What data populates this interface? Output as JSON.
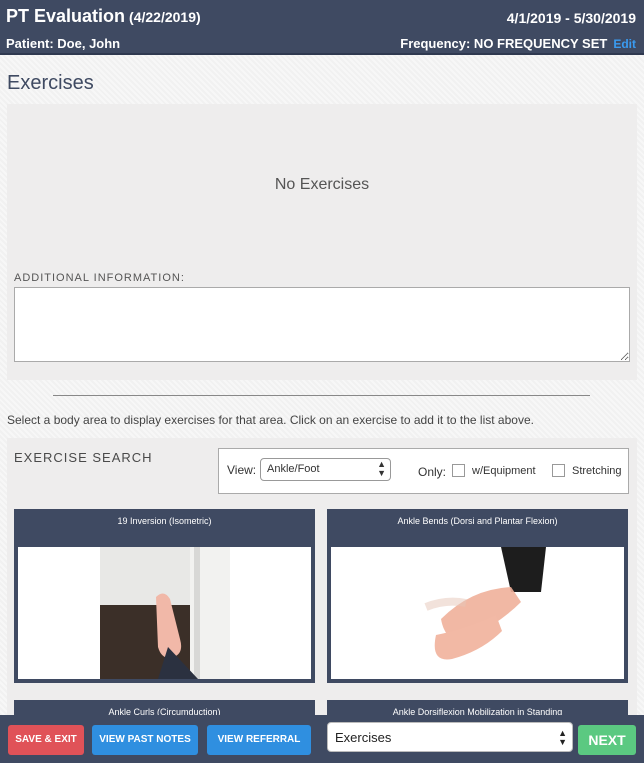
{
  "header": {
    "title": "PT Evaluation",
    "date": "(4/22/2019)",
    "range": "4/1/2019 - 5/30/2019",
    "patient": "Patient: Doe, John",
    "frequency": "Frequency: NO FREQUENCY SET",
    "edit_label": "Edit"
  },
  "section_title": "Exercises",
  "exercises_panel": {
    "empty_text": "No Exercises",
    "additional_label": "ADDITIONAL INFORMATION:",
    "additional_value": ""
  },
  "instruction": "Select a body area to display exercises for that area. Click on an exercise to add it to the list above.",
  "search": {
    "title": "EXERCISE SEARCH",
    "view_label": "View:",
    "view_value": "Ankle/Foot",
    "only_label": "Only:",
    "equipment_label": "w/Equipment",
    "stretching_label": "Stretching"
  },
  "cards": [
    {
      "title": "19 Inversion (Isometric)"
    },
    {
      "title": "Ankle Bends (Dorsi and Plantar Flexion)"
    },
    {
      "title": "Ankle Curls (Circumduction)"
    },
    {
      "title": "Ankle Dorsiflexion Mobilization in Standing"
    }
  ],
  "bottom_bar": {
    "save_exit": "SAVE & EXIT",
    "view_past_notes": "VIEW PAST NOTES",
    "view_referral": "VIEW REFERRAL",
    "section_select": "Exercises",
    "next": "NEXT"
  },
  "colors": {
    "header_bg": "#3f4a62",
    "accent_blue": "#2f8fe0",
    "save_red": "#e05258",
    "next_green": "#5bc981"
  }
}
